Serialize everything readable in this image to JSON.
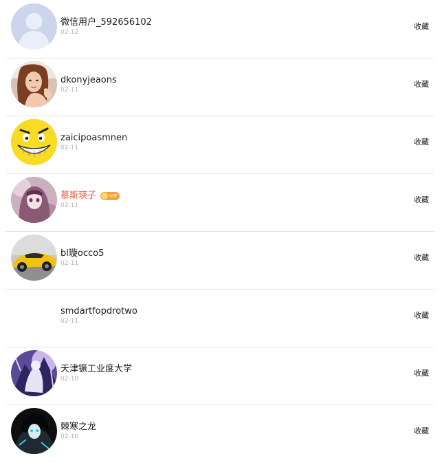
{
  "users": [
    {
      "name": "微信用户_592656102",
      "date": "02-12",
      "action": "收藏",
      "avatar": "default-avatar-icon",
      "vip": false
    },
    {
      "name": "dkonyjeaons",
      "date": "02-11",
      "action": "收藏",
      "avatar": "woman-photo",
      "vip": false
    },
    {
      "name": "zaicipoasmnen",
      "date": "02-11",
      "action": "收藏",
      "avatar": "yellow-smiley-face",
      "vip": false
    },
    {
      "name": "慕斯瑛子",
      "date": "02-11",
      "action": "收藏",
      "avatar": "anime-girl",
      "vip": true,
      "vip_label": "VIP"
    },
    {
      "name": "bl璇occo5",
      "date": "02-11",
      "action": "收藏",
      "avatar": "yellow-sports-car",
      "vip": false
    },
    {
      "name": "smdartfopdrotwo",
      "date": "02-11",
      "action": "收藏",
      "avatar": "none",
      "vip": false
    },
    {
      "name": "天津镢工业度大学",
      "date": "02-10",
      "action": "收藏",
      "avatar": "anime-art",
      "vip": false
    },
    {
      "name": "棘寒之龙",
      "date": "02-10",
      "action": "收藏",
      "avatar": "dark-anime-character",
      "vip": false
    }
  ],
  "colors": {
    "vip_name": "#e8604a",
    "date": "#b0b0b0",
    "divider": "#e6e6e6",
    "vip_badge": "#f3a43a"
  }
}
